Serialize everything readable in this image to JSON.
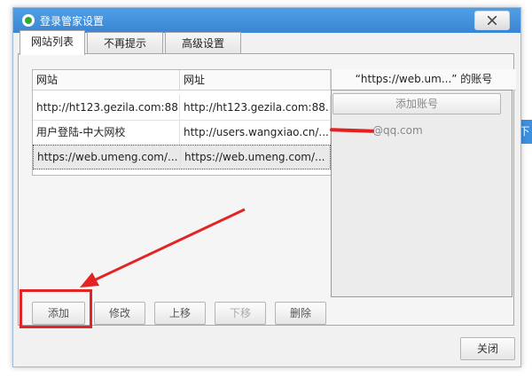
{
  "window": {
    "title": "登录管家设置"
  },
  "tabs": [
    {
      "label": "网站列表"
    },
    {
      "label": "不再提示"
    },
    {
      "label": "高级设置"
    }
  ],
  "table": {
    "columns": [
      "网站",
      "网址"
    ],
    "rows": [
      {
        "site": "http://ht123.gezila.com:88...",
        "url": "http://ht123.gezila.com:88..."
      },
      {
        "site": "用户登陆-中大网校",
        "url": "http://users.wangxiao.cn/..."
      },
      {
        "site": "https://web.umeng.com/...",
        "url": "https://web.umeng.com/..."
      }
    ]
  },
  "accounts": {
    "header": "“https://web.um...” 的账号",
    "add_button": "添加账号",
    "items": [
      "@qq.com"
    ]
  },
  "actions": {
    "add": "添加",
    "edit": "修改",
    "move_up": "上移",
    "move_down": "下移",
    "delete": "删除"
  },
  "close_button": "关闭",
  "side_tab": "下",
  "colors": {
    "titlebar": "#3a85d4",
    "annotation": "#e32424"
  }
}
